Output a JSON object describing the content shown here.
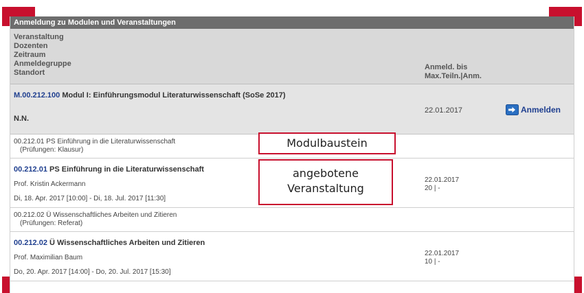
{
  "colors": {
    "accent": "#c8102e",
    "link": "#1f3f8f",
    "titlebar": "#6d6d6d",
    "header_bg": "#d9d9d9"
  },
  "panel": {
    "title": "Anmeldung zu Modulen und Veranstaltungen"
  },
  "header": {
    "left_labels": [
      "Veranstaltung",
      "Dozenten",
      "Zeitraum",
      "Anmeldegruppe",
      "Standort"
    ],
    "right_labels": [
      "Anmeld. bis",
      "Max.Teiln.|Anm."
    ]
  },
  "module": {
    "code": "M.00.212.100",
    "title": "Modul I: Einführungsmodul Literaturwissenschaft (SoSe 2017)",
    "lecturer": "N.N.",
    "deadline": "22.01.2017",
    "register_label": "Anmelden",
    "register_icon": "login-arrow-icon"
  },
  "rows": [
    {
      "type": "baustein",
      "line1": "00.212.01 PS Einführung in die Literaturwissenschaft",
      "line2": "(Prüfungen: Klausur)"
    },
    {
      "type": "veranstaltung",
      "code": "00.212.01",
      "title": "PS Einführung in die Literaturwissenschaft",
      "lecturer": "Prof. Kristin Ackermann",
      "time": "Di, 18. Apr. 2017 [10:00] - Di, 18. Jul. 2017 [11:30]",
      "deadline": "22.01.2017",
      "capacity": "20 | -"
    },
    {
      "type": "baustein",
      "line1": "00.212.02 Ü Wissenschaftliches Arbeiten und Zitieren",
      "line2": "(Prüfungen: Referat)"
    },
    {
      "type": "veranstaltung",
      "code": "00.212.02",
      "title": "Ü Wissenschaftliches Arbeiten und Zitieren",
      "lecturer": "Prof. Maximilian Baum",
      "time": "Do, 20. Apr. 2017 [14:00] - Do, 20. Jul. 2017 [15:30]",
      "deadline": "22.01.2017",
      "capacity": "10 | -"
    }
  ],
  "annotations": {
    "modulbaustein": "Modulbaustein",
    "veranstaltung_line1": "angebotene",
    "veranstaltung_line2": "Veranstaltung"
  }
}
